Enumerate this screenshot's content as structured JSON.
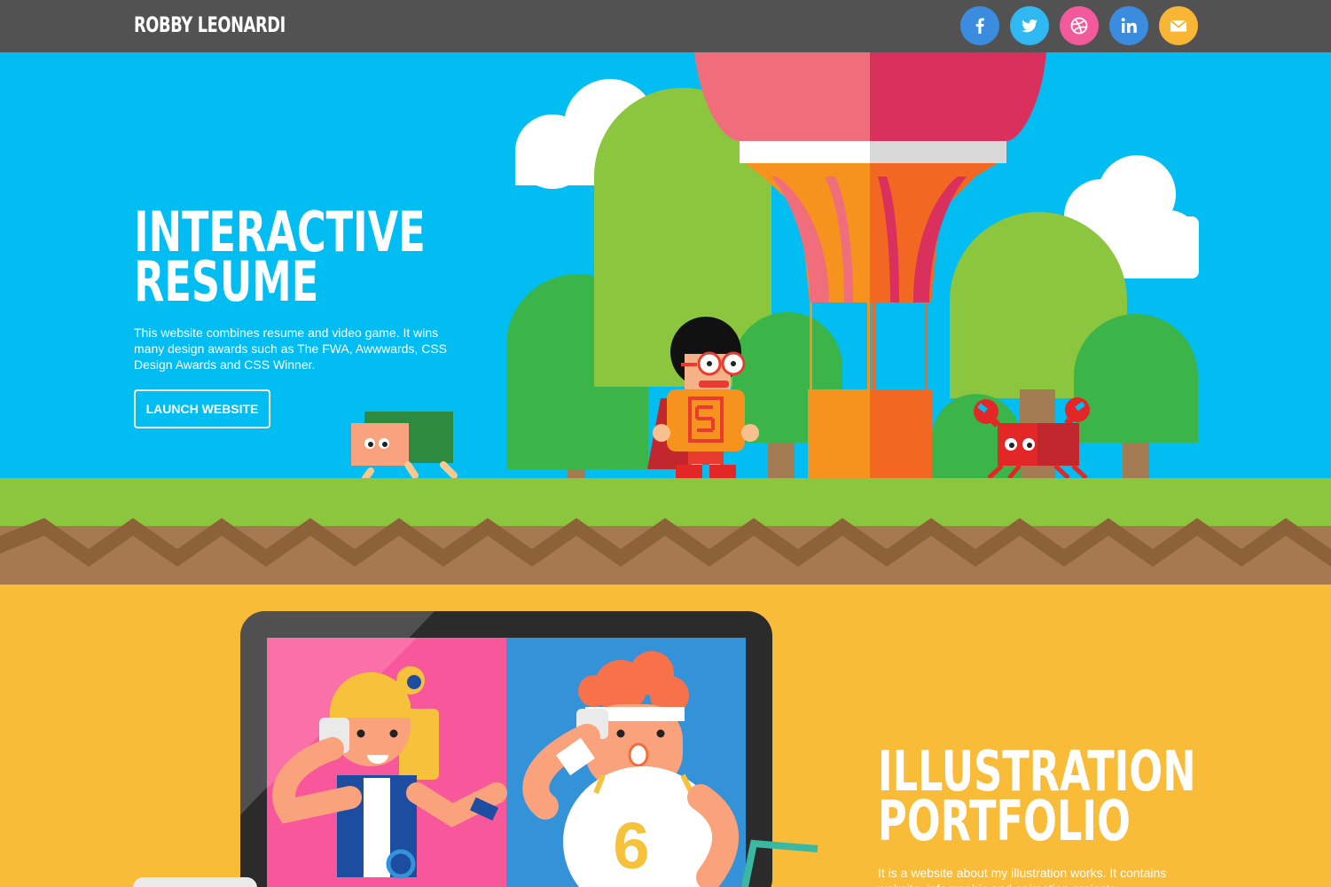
{
  "header": {
    "brand": "ROBBY LEONARDI",
    "social": [
      {
        "name": "facebook",
        "icon": "facebook-icon",
        "color": "#3a8dde"
      },
      {
        "name": "twitter",
        "icon": "twitter-icon",
        "color": "#2fb8f2"
      },
      {
        "name": "dribbble",
        "icon": "dribbble-icon",
        "color": "#f25a9b"
      },
      {
        "name": "linkedin",
        "icon": "linkedin-icon",
        "color": "#3a8dde"
      },
      {
        "name": "email",
        "icon": "mail-icon",
        "color": "#f9b534"
      }
    ]
  },
  "resume": {
    "title_line1": "INTERACTIVE",
    "title_line2": "RESUME",
    "description": "This website combines resume and video game. It wins many design awards such as The FWA, Awwwards, CSS Design Awards and CSS Winner.",
    "button": "LAUNCH WEBSITE"
  },
  "portfolio": {
    "title_line1": "ILLUSTRATION",
    "title_line2": "PORTFOLIO",
    "description": "It is a website about my illustration works. It contains website, infographic and animation projects."
  },
  "colors": {
    "header_bg": "#525252",
    "sky": "#01bdf2",
    "grass": "#8cc63f",
    "dirt": "#a67a51",
    "portfolio_bg": "#f9bc38"
  }
}
